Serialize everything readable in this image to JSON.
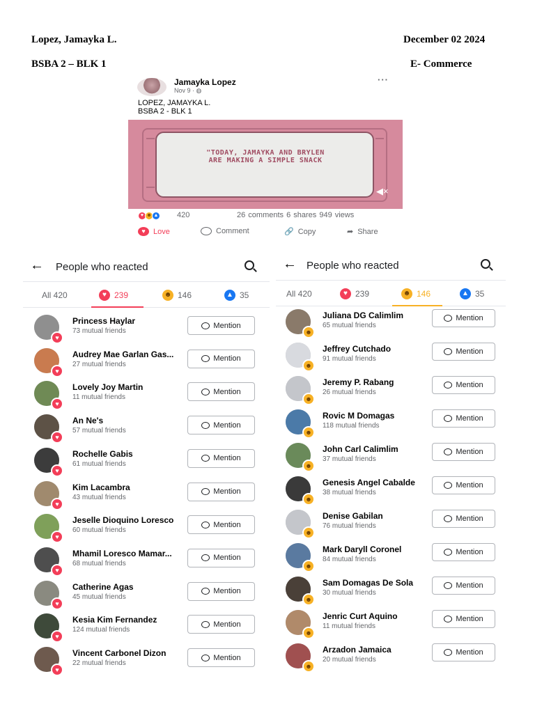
{
  "document": {
    "name": "Lopez, Jamayka L.",
    "date": "December 02 2024",
    "section": "BSBA 2 – BLK 1",
    "subject": "E- Commerce"
  },
  "post": {
    "author": "Jamayka Lopez",
    "meta": "Nov 9 · ◍",
    "more": "···",
    "caption_line1": "LOPEZ, JAMAYKA L.",
    "caption_line2": "BSBA 2 - BLK 1",
    "video_text_line1": "\"TODAY, JAMAYKA AND BRYLEN",
    "video_text_line2": "ARE MAKING A SIMPLE SNACK",
    "reaction_count": "420",
    "stats": "26 comments  6 shares  949 views",
    "actions": {
      "love": "Love",
      "comment": "Comment",
      "copy": "Copy",
      "share": "Share"
    }
  },
  "reactions_panel_left": {
    "title": "People who reacted",
    "tabs": {
      "all": "All 420",
      "love": "239",
      "haha": "146",
      "like": "35"
    },
    "mention_label": "Mention",
    "people": [
      {
        "name": "Princess Haylar",
        "mutual": "73 mutual friends",
        "color": "#8f8f8f"
      },
      {
        "name": "Audrey Mae Garlan Gas...",
        "mutual": "27 mutual friends",
        "color": "#c97b4f"
      },
      {
        "name": "Lovely Joy Martin",
        "mutual": "11 mutual friends",
        "color": "#6f8a55"
      },
      {
        "name": "An Ne's",
        "mutual": "57 mutual friends",
        "color": "#5d5246"
      },
      {
        "name": "Rochelle Gabis",
        "mutual": "61 mutual friends",
        "color": "#3c3c3c"
      },
      {
        "name": "Kim Lacambra",
        "mutual": "43 mutual friends",
        "color": "#a08a6e"
      },
      {
        "name": "Jeselle Dioquino Loresco",
        "mutual": "60 mutual friends",
        "color": "#7fa05a"
      },
      {
        "name": "Mhamil Loresco Mamar...",
        "mutual": "68 mutual friends",
        "color": "#4e4e4e"
      },
      {
        "name": "Catherine Agas",
        "mutual": "45 mutual friends",
        "color": "#8a8a80"
      },
      {
        "name": "Kesia Kim Fernandez",
        "mutual": "124 mutual friends",
        "color": "#3e4a3a"
      },
      {
        "name": "Vincent Carbonel Dizon",
        "mutual": "22 mutual friends",
        "color": "#6e5a4e"
      }
    ]
  },
  "reactions_panel_right": {
    "title": "People who reacted",
    "tabs": {
      "all": "All 420",
      "love": "239",
      "haha": "146",
      "like": "35"
    },
    "mention_label": "Mention",
    "people": [
      {
        "name": "Juliana DG Calimlim",
        "mutual": "65 mutual friends",
        "color": "#8a7a6a"
      },
      {
        "name": "Jeffrey Cutchado",
        "mutual": "91 mutual friends",
        "color": "#d8dadf"
      },
      {
        "name": "Jeremy P. Rabang",
        "mutual": "26 mutual friends",
        "color": "#c4c6cb"
      },
      {
        "name": "Rovic M Domagas",
        "mutual": "118 mutual friends",
        "color": "#4b7aa8"
      },
      {
        "name": "John Carl Calimlim",
        "mutual": "37 mutual friends",
        "color": "#6a8a5a"
      },
      {
        "name": "Genesis Angel Cabalde",
        "mutual": "38 mutual friends",
        "color": "#3a3a3a"
      },
      {
        "name": "Denise Gabilan",
        "mutual": "76 mutual friends",
        "color": "#c4c6cb"
      },
      {
        "name": "Mark Daryll Coronel",
        "mutual": "84 mutual friends",
        "color": "#5a7aa0"
      },
      {
        "name": "Sam Domagas De Sola",
        "mutual": "30 mutual friends",
        "color": "#4a4038"
      },
      {
        "name": "Jenric Curt Aquino",
        "mutual": "11 mutual friends",
        "color": "#b08a6a"
      },
      {
        "name": "Arzadon Jamaica",
        "mutual": "20 mutual friends",
        "color": "#a05050"
      }
    ]
  },
  "colors": {
    "love": "#f33e58",
    "haha": "#f7b125",
    "like": "#1877f2",
    "video_bg": "#d68a9d"
  }
}
